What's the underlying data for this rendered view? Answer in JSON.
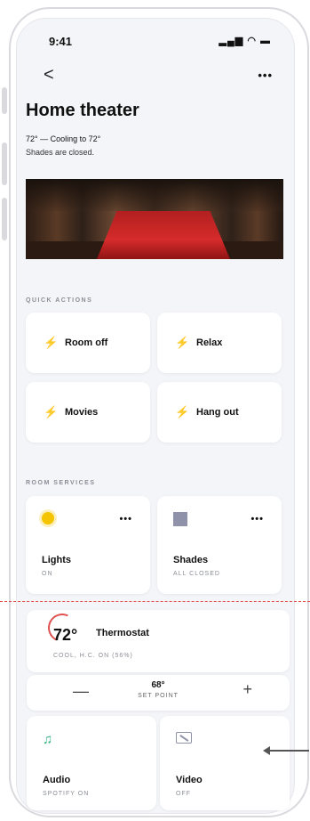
{
  "status_bar": {
    "time": "9:41",
    "icons": "••• ▲ ▬"
  },
  "nav": {
    "back": "<",
    "more": "•••"
  },
  "room": {
    "title": "Home theater",
    "climate_summary": "72° — Cooling to 72°",
    "shades_summary": "Shades are closed."
  },
  "quick_actions": {
    "label": "QUICK ACTIONS",
    "items": [
      {
        "label": "Room off",
        "icon": "bolt-icon"
      },
      {
        "label": "Relax",
        "icon": "bolt-icon"
      },
      {
        "label": "Movies",
        "icon": "bolt-icon"
      },
      {
        "label": "Hang out",
        "icon": "bolt-icon"
      }
    ]
  },
  "room_services": {
    "label": "ROOM SERVICES",
    "lights": {
      "name": "Lights",
      "state": "ON",
      "more": "•••"
    },
    "shades": {
      "name": "Shades",
      "state": "ALL CLOSED",
      "more": "•••"
    },
    "thermostat": {
      "temp": "72°",
      "name": "Thermostat",
      "state": "COOL, H.C. ON (56%)",
      "set_point_value": "68°",
      "set_point_caption": "SET POINT",
      "minus": "—",
      "plus": "+"
    },
    "audio": {
      "name": "Audio",
      "state": "SPOTIFY ON",
      "icon": "♫"
    },
    "video": {
      "name": "Video",
      "state": "OFF"
    }
  },
  "colors": {
    "accent_bolt": "#f5b800",
    "sun": "#f5c400",
    "music": "#2cae7a",
    "thermo_arc": "#e05050"
  }
}
